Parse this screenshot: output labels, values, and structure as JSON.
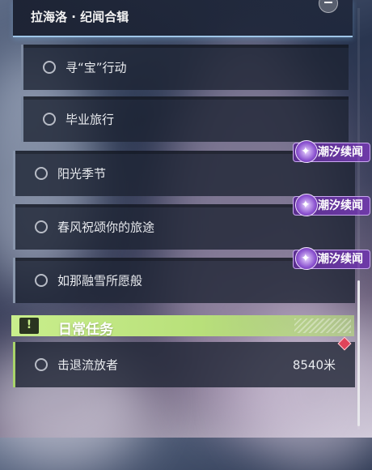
{
  "header": {
    "title": "拉海洛 · 纪闻合辑"
  },
  "subquests": [
    {
      "label": "寻“宝”行动"
    },
    {
      "label": "毕业旅行"
    }
  ],
  "quests": [
    {
      "label": "阳光季节",
      "tag": "潮汐续闻"
    },
    {
      "label": "春风祝颂你的旅途",
      "tag": "潮汐续闻"
    },
    {
      "label": "如那融雪所愿般",
      "tag": "潮汐续闻"
    }
  ],
  "daily": {
    "title": "日常任务",
    "quest": {
      "label": "击退流放者",
      "distance": "8540米"
    }
  },
  "colors": {
    "tag_purple": "#6e3aa8",
    "daily_green": "#c9ee8c",
    "marker_red": "#e0445a"
  }
}
